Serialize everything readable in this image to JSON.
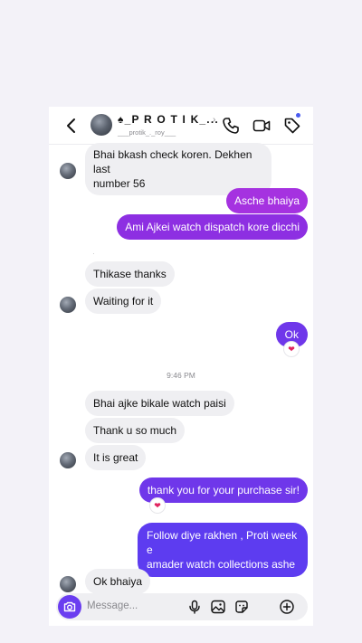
{
  "header": {
    "name": "♠_P R O T I K_...",
    "username": "___protik_._roy___",
    "chevron": "›"
  },
  "messages": {
    "m1": "Bhai bkash check koren. Dekhen last",
    "m1b": "number 56",
    "m2": "Asche bhaiya",
    "m3": "Ami Ajkei watch dispatch kore dicchi",
    "m4": "Thikase thanks",
    "m5": "Waiting for it",
    "m6": "Ok",
    "time": "9:46 PM",
    "m7": "Bhai ajke bikale watch paisi",
    "m8": "Thank u so much",
    "m9": "It is great",
    "m10": "thank you for your purchase sir!",
    "m11": "Follow diye rakhen , Proti week e",
    "m11b": "amader watch collections ashe",
    "m12": "Ok bhaiya",
    "reaction": "❤"
  },
  "composer": {
    "placeholder": "Message..."
  },
  "colors": {
    "accent": "#6f37ea",
    "notification_dot": "#4a5cf0"
  },
  "icons": [
    "back-icon",
    "phone-icon",
    "video-icon",
    "tag-icon",
    "camera-icon",
    "mic-icon",
    "gallery-icon",
    "sticker-icon",
    "add-icon"
  ]
}
